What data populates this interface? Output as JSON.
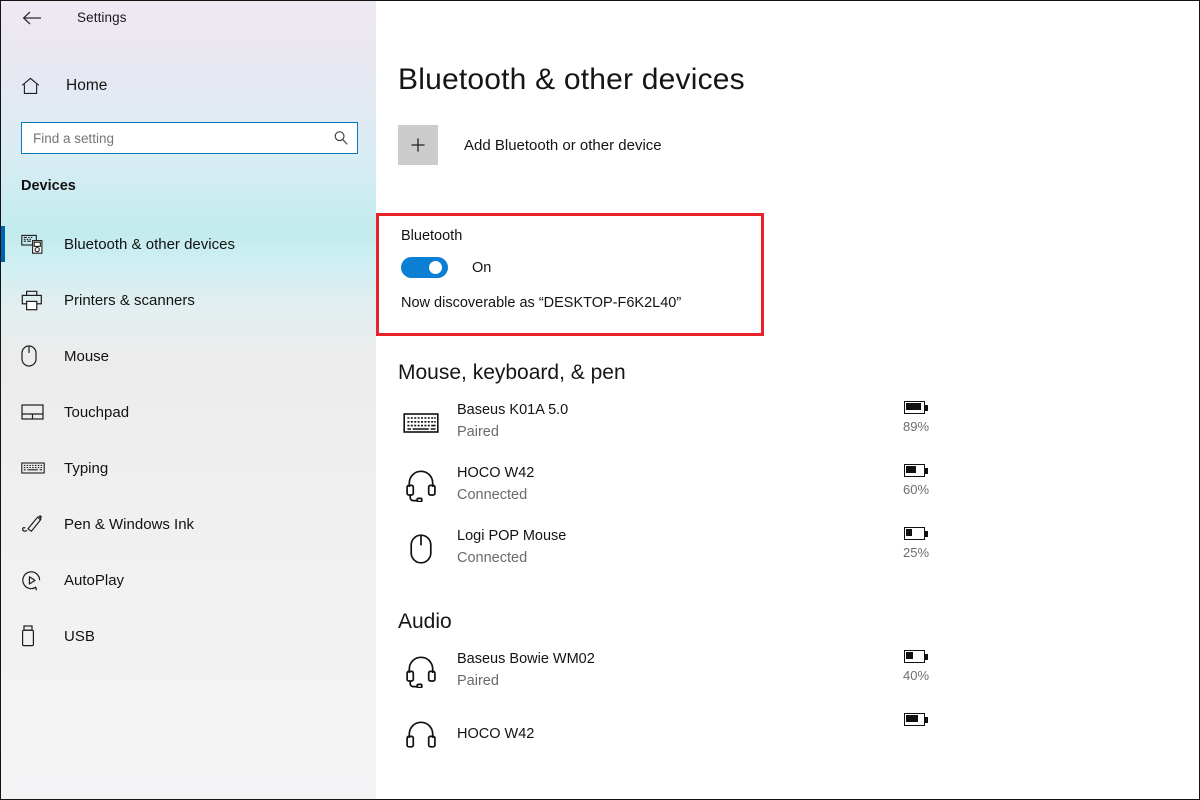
{
  "window": {
    "back_icon": "back-arrow-icon",
    "title": "Settings"
  },
  "sidebar": {
    "home": {
      "label": "Home",
      "icon": "home-icon"
    },
    "search": {
      "placeholder": "Find a setting",
      "value": "",
      "icon": "search-icon"
    },
    "section_label": "Devices",
    "accent_color": "#0063b1",
    "items": [
      {
        "label": "Bluetooth & other devices",
        "icon": "bluetooth-devices-icon",
        "selected": true
      },
      {
        "label": "Printers & scanners",
        "icon": "printer-icon",
        "selected": false
      },
      {
        "label": "Mouse",
        "icon": "mouse-icon",
        "selected": false
      },
      {
        "label": "Touchpad",
        "icon": "touchpad-icon",
        "selected": false
      },
      {
        "label": "Typing",
        "icon": "keyboard-icon",
        "selected": false
      },
      {
        "label": "Pen & Windows Ink",
        "icon": "pen-icon",
        "selected": false
      },
      {
        "label": "AutoPlay",
        "icon": "autoplay-icon",
        "selected": false
      },
      {
        "label": "USB",
        "icon": "usb-icon",
        "selected": false
      }
    ]
  },
  "main": {
    "page_title": "Bluetooth & other devices",
    "add_device": {
      "label": "Add Bluetooth or other device",
      "icon": "plus-icon"
    },
    "bluetooth": {
      "label": "Bluetooth",
      "toggle_state": "On",
      "toggle_on": true,
      "toggle_color": "#0a7fd4",
      "highlight_color": "#e8232a",
      "discoverable_text": "Now discoverable as “DESKTOP-F6K2L40”"
    },
    "groups": [
      {
        "title": "Mouse, keyboard, & pen",
        "devices": [
          {
            "name": "Baseus K01A 5.0",
            "status": "Paired",
            "icon": "keyboard-icon",
            "battery": "89%",
            "battery_level": 89
          },
          {
            "name": "HOCO W42",
            "status": "Connected",
            "icon": "headset-icon",
            "battery": "60%",
            "battery_level": 60
          },
          {
            "name": "Logi POP Mouse",
            "status": "Connected",
            "icon": "mouse-icon",
            "battery": "25%",
            "battery_level": 25
          }
        ]
      },
      {
        "title": "Audio",
        "devices": [
          {
            "name": "Baseus Bowie WM02",
            "status": "Paired",
            "icon": "headset-icon",
            "battery": "40%",
            "battery_level": 40
          },
          {
            "name": "HOCO W42",
            "status": "",
            "icon": "headphones-icon",
            "battery": "",
            "battery_level": 70
          }
        ]
      }
    ]
  }
}
